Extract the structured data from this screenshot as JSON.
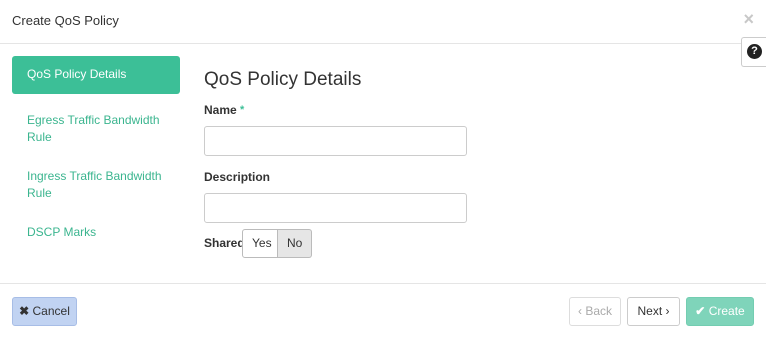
{
  "modal": {
    "title": "Create QoS Policy",
    "close_icon": "×",
    "help_icon": "?"
  },
  "sidebar": {
    "items": [
      {
        "label": "QoS Policy Details",
        "active": true
      },
      {
        "label": "Egress Traffic Bandwidth Rule",
        "active": false
      },
      {
        "label": "Ingress Traffic Bandwidth Rule",
        "active": false
      },
      {
        "label": "DSCP Marks",
        "active": false
      }
    ]
  },
  "form": {
    "section_title": "QoS Policy Details",
    "name_label": "Name",
    "required_marker": "*",
    "name_value": "",
    "description_label": "Description",
    "description_value": "",
    "shared_label": "Shared",
    "shared_yes": "Yes",
    "shared_no": "No",
    "shared_selected": "No"
  },
  "footer": {
    "cancel_icon": "✖",
    "cancel_label": "Cancel",
    "back_label": "‹ Back",
    "next_label": "Next ›",
    "create_icon": "✔",
    "create_label": "Create"
  },
  "colors": {
    "accent": "#3cbf97",
    "cancel_bg": "#c1d3f2",
    "create_bg": "#7fd4ba"
  }
}
